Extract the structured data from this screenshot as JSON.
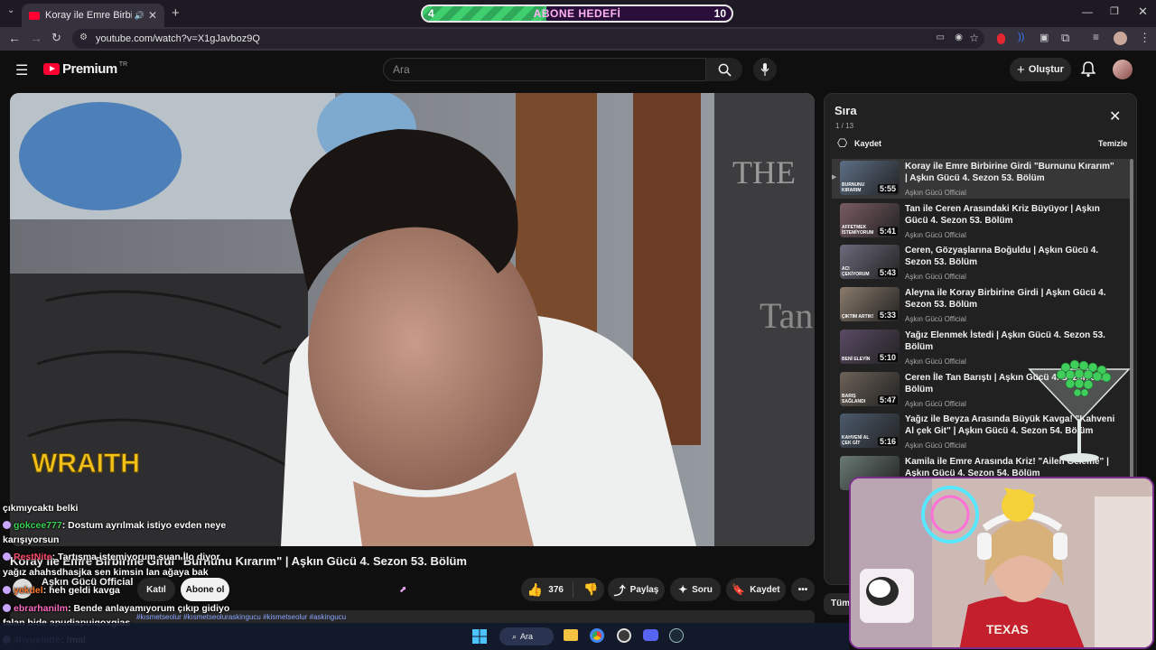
{
  "browser": {
    "tab_title": "Koray ile Emre Birbirine Girdi \"Burnunu Kırarım\" | Aşkın Gücü 4. Sezon 53. Bölüm",
    "url": "youtube.com/watch?v=X1gJavboz9Q"
  },
  "goal": {
    "label": "ABONE HEDEFİ",
    "current": "4",
    "target": "10",
    "progress": 0.4
  },
  "youtube": {
    "logo_text": "Premium",
    "logo_region": "TR",
    "search_placeholder": "Ara",
    "create_label": "Oluştur"
  },
  "video": {
    "title": "Koray ile Emre Birbirine Girdi \"Burnunu Kırarım\" | Aşkın Gücü 4. Sezon 53. Bölüm",
    "channel": "Aşkın Gücü Official",
    "join_label": "Katıl",
    "subscribe_label": "Abone ol",
    "likes": "376",
    "share_label": "Paylaş",
    "ask_label": "Soru",
    "save_label": "Kaydet",
    "watermark": "WRAITH",
    "hashtags": "#kısmetseolur #kısmetseoluraskingucu #kismetseolur #askingucu"
  },
  "queue": {
    "title": "Sıra",
    "position": "1 / 13",
    "save_label": "Kaydet",
    "clear_label": "Temizle",
    "items": [
      {
        "title": "Koray ile Emre Birbirine Girdi \"Burnunu Kırarım\" | Aşkın Gücü 4. Sezon 53. Bölüm",
        "channel": "Aşkın Gücü Official",
        "duration": "5:55",
        "thumb_text": "BURNUNU KIRARIM",
        "active": true
      },
      {
        "title": "Tan ile Ceren Arasındaki Kriz Büyüyor | Aşkın Gücü 4. Sezon 53. Bölüm",
        "channel": "Aşkın Gücü Official",
        "duration": "5:41",
        "thumb_text": "AFFETMEK İSTEMİYORUM"
      },
      {
        "title": "Ceren, Gözyaşlarına Boğuldu | Aşkın Gücü 4. Sezon 53. Bölüm",
        "channel": "Aşkın Gücü Official",
        "duration": "5:43",
        "thumb_text": "ACI ÇEKİYORUM"
      },
      {
        "title": "Aleyna ile Koray Birbirine Girdi | Aşkın Gücü 4. Sezon 53. Bölüm",
        "channel": "Aşkın Gücü Official",
        "duration": "5:33",
        "thumb_text": "ÇIKTIM ARTIK!"
      },
      {
        "title": "Yağız Elenmek İstedi | Aşkın Gücü 4. Sezon 53. Bölüm",
        "channel": "Aşkın Gücü Official",
        "duration": "5:10",
        "thumb_text": "BENİ ELEYİN"
      },
      {
        "title": "Ceren İle Tan Barıştı | Aşkın Gücü 4. Sezon 53. Bölüm",
        "channel": "Aşkın Gücü Official",
        "duration": "5:47",
        "thumb_text": "BARIŞ SAĞLANDI"
      },
      {
        "title": "Yağız ile Beyza Arasında Büyük Kavga! \"Kahveni Al çek Git\" | Aşkın Gücü 4. Sezon 54. Bölüm",
        "channel": "Aşkın Gücü Official",
        "duration": "5:16",
        "thumb_text": "KAHVENİ AL ÇEK GİT"
      },
      {
        "title": "Kamila ile Emre Arasında Kriz! \"Ailen Geleme\" | Aşkın Gücü 4. Sezon 54. Bölüm",
        "channel": "Aşkın Gücü Official",
        "duration": "",
        "thumb_text": ""
      }
    ],
    "bottom_chip": "Tüm"
  },
  "chat": [
    {
      "user": "",
      "text": "çıkmıycaktı belki",
      "color": "#ffffff"
    },
    {
      "user": "gokcee777",
      "text": ": Dostum ayrılmak istiyo evden neye",
      "color": "#39d353"
    },
    {
      "user": "",
      "text": "karışıyorsun",
      "color": "#ffffff"
    },
    {
      "user": "RestNite",
      "text": ": Tartışma istemiyorum şuan İlo diyor",
      "color": "#ff4d6d"
    },
    {
      "user": "",
      "text": "yağız ahahsdhasjka sen kimsin lan ağaya bak",
      "color": "#ffffff"
    },
    {
      "user": "yekdel",
      "text": ": heh geldi kavga",
      "color": "#ff7a2e"
    },
    {
      "user": "ebrarhanilm",
      "text": ": Bende anlayamıyorum çıkıp gidiyo",
      "color": "#ff6ac1"
    },
    {
      "user": "",
      "text": "falan bide apudiapuiqoxgias",
      "color": "#ffffff"
    },
    {
      "user": "4hypelatte",
      "text": ": !mal",
      "color": "#b57bff"
    }
  ],
  "taskbar": {
    "search_label": "Ara"
  }
}
